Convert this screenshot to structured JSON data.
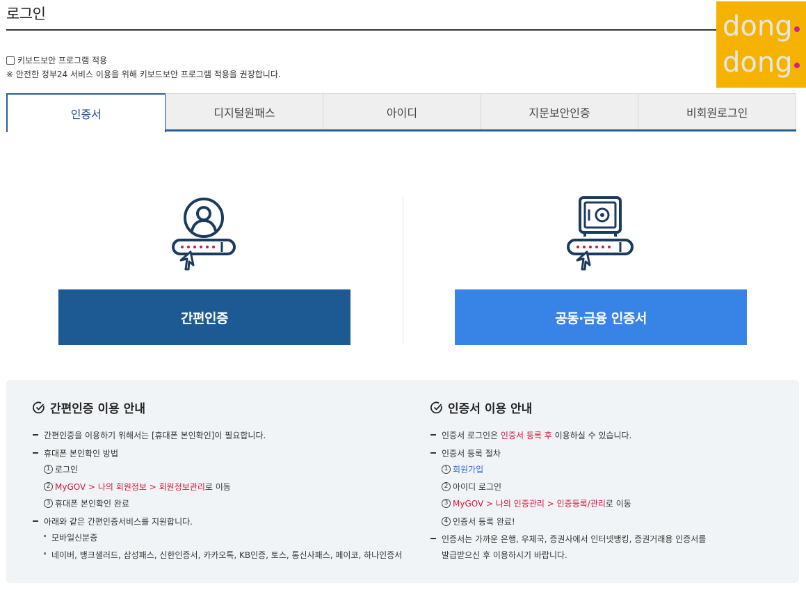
{
  "page": {
    "title": "로그인"
  },
  "watermark": {
    "line1": "dong",
    "line2": "dong"
  },
  "keyboard_security": {
    "label": "키보드보안 프로그램 적용",
    "note": "※ 안전한 정부24 서비스 이용을 위해 키보드보안 프로그램 적용을 권장합니다."
  },
  "tabs": [
    {
      "label": "인증서",
      "active": true
    },
    {
      "label": "디지털원패스",
      "active": false
    },
    {
      "label": "아이디",
      "active": false
    },
    {
      "label": "지문보안인증",
      "active": false
    },
    {
      "label": "비회원로그인",
      "active": false
    }
  ],
  "buttons": {
    "simple_auth": "간편인증",
    "joint_cert": "공동·금융 인증서"
  },
  "icons": {
    "simple_auth": "person-key-icon",
    "joint_cert": "safe-key-icon",
    "guide_check": "check-circle-icon"
  },
  "colors": {
    "primary_dark": "#1d5a94",
    "primary_light": "#3784e6",
    "accent_red": "#d3163a",
    "link_blue": "#2a6bd1",
    "watermark_bg": "#f5b300"
  },
  "guide": {
    "simple": {
      "title": "간편인증 이용 안내",
      "line1": "간편인증을 이용하기 위해서는 [휴대폰 본인확인]이 필요합니다.",
      "line2": "휴대폰 본인확인 방법",
      "step1_num": "1",
      "step1": "로그인",
      "step2_num": "2",
      "step2_red": "MyGOV > 나의 회원정보 > 회원정보관리",
      "step2_rest": "로 이동",
      "step3_num": "3",
      "step3": "휴대폰 본인확인 완료",
      "line3": "아래와 같은 간편인증서비스를 지원합니다.",
      "bullet1": "모바일신분증",
      "bullet2": "네이버, 뱅크샐러드, 삼성패스, 신한인증서, 카카오톡, KB인증, 토스, 통신사패스, 페이코, 하나인증서"
    },
    "cert": {
      "title": "인증서 이용 안내",
      "line1_pre": "인증서 로그인은 ",
      "line1_red": "인증서 등록 후",
      "line1_post": " 이용하실 수 있습니다.",
      "line2": "인증서 등록 절차",
      "step1_num": "1",
      "step1_blue": "회원가입",
      "step2_num": "2",
      "step2": "아이디 로그인",
      "step3_num": "3",
      "step3_red": "MyGOV > 나의 인증관리 > 인증등록/관리",
      "step3_rest": "로 이동",
      "step4_num": "4",
      "step4": "인증서 등록 완료!",
      "line3a": "인증서는 가까운 은행, 우체국, 증권사에서 인터넷뱅킹, 증권거래용 인증서를",
      "line3b": "발급받으신 후 이용하시기 바랍니다."
    }
  }
}
